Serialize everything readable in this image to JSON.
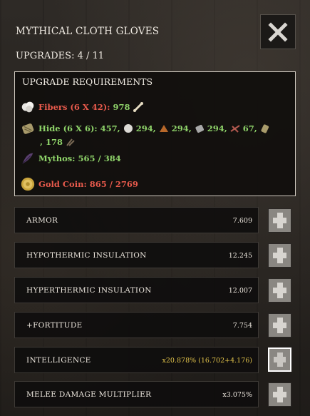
{
  "item": {
    "title": "MYTHICAL CLOTH GLOVES",
    "upgrades_label": "UPGRADES: 4 / 11"
  },
  "requirements": {
    "title": "UPGRADE REQUIREMENTS",
    "fibers": {
      "label": "Fibers (6 X 42):",
      "amount": "978"
    },
    "hide": {
      "label": "Hide (6 X 6):",
      "amounts": [
        "457",
        "294",
        "294",
        "294",
        "67",
        "178"
      ]
    },
    "mythos": {
      "label": "Mythos: 565 / 384"
    },
    "gold": {
      "label": "Gold Coin: 865 / 2769"
    }
  },
  "stats": [
    {
      "name": "ARMOR",
      "value": "7.609",
      "highlight": false
    },
    {
      "name": "HYPOTHERMIC INSULATION",
      "value": "12.245",
      "highlight": false
    },
    {
      "name": "HYPERTHERMIC INSULATION",
      "value": "12.007",
      "highlight": false
    },
    {
      "name": "+FORTITUDE",
      "value": "7.754",
      "highlight": false
    },
    {
      "name": "INTELLIGENCE",
      "value": "x20.878% (16.702+4.176)",
      "highlight": true
    },
    {
      "name": "MELEE DAMAGE MULTIPLIER",
      "value": "x3.075%",
      "highlight": false
    }
  ],
  "icons": {
    "close": "close-x-icon",
    "plus": "plus-icon",
    "fibers": "fibers-cotton-icon",
    "hide": "hide-leather-icon",
    "mythos": "mythos-feather-icon",
    "gold": "gold-coin-icon"
  }
}
